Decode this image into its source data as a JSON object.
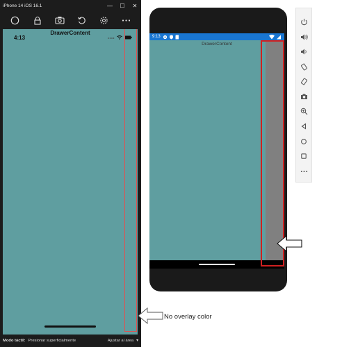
{
  "ios_simulator": {
    "window_title": "iPhone 14 iOS 16.1",
    "window_controls": {
      "minimize": "—",
      "maximize": "☐",
      "close": "✕"
    },
    "toolbar": [
      {
        "name": "home-icon"
      },
      {
        "name": "lock-icon"
      },
      {
        "name": "screenshot-icon"
      },
      {
        "name": "rotate-icon"
      },
      {
        "name": "settings-icon"
      },
      {
        "name": "more-icon"
      }
    ],
    "status_time": "4:13",
    "page_title": "DrawerContent",
    "content_color": "#5f9ea0",
    "bottom_bar": {
      "touch_mode_label": "Modo táctil:",
      "touch_mode_value": "Presionar superficialmente",
      "fit_label": "Ajustar al área",
      "dropdown_glyph": "▾"
    }
  },
  "annotation": {
    "label": "No overlay color"
  },
  "android_emulator": {
    "status_time": "9:13",
    "status_color": "#1976d2",
    "page_title": "DrawerContent",
    "overlay_strip_color": "#808080",
    "side_toolbar": [
      {
        "name": "power-icon"
      },
      {
        "name": "volume-up-icon"
      },
      {
        "name": "volume-down-icon"
      },
      {
        "name": "rotate-left-icon"
      },
      {
        "name": "rotate-right-icon"
      },
      {
        "name": "camera-icon"
      },
      {
        "name": "zoom-icon"
      },
      {
        "name": "back-icon"
      },
      {
        "name": "home-icon"
      },
      {
        "name": "overview-icon"
      },
      {
        "name": "more-icon"
      }
    ]
  }
}
